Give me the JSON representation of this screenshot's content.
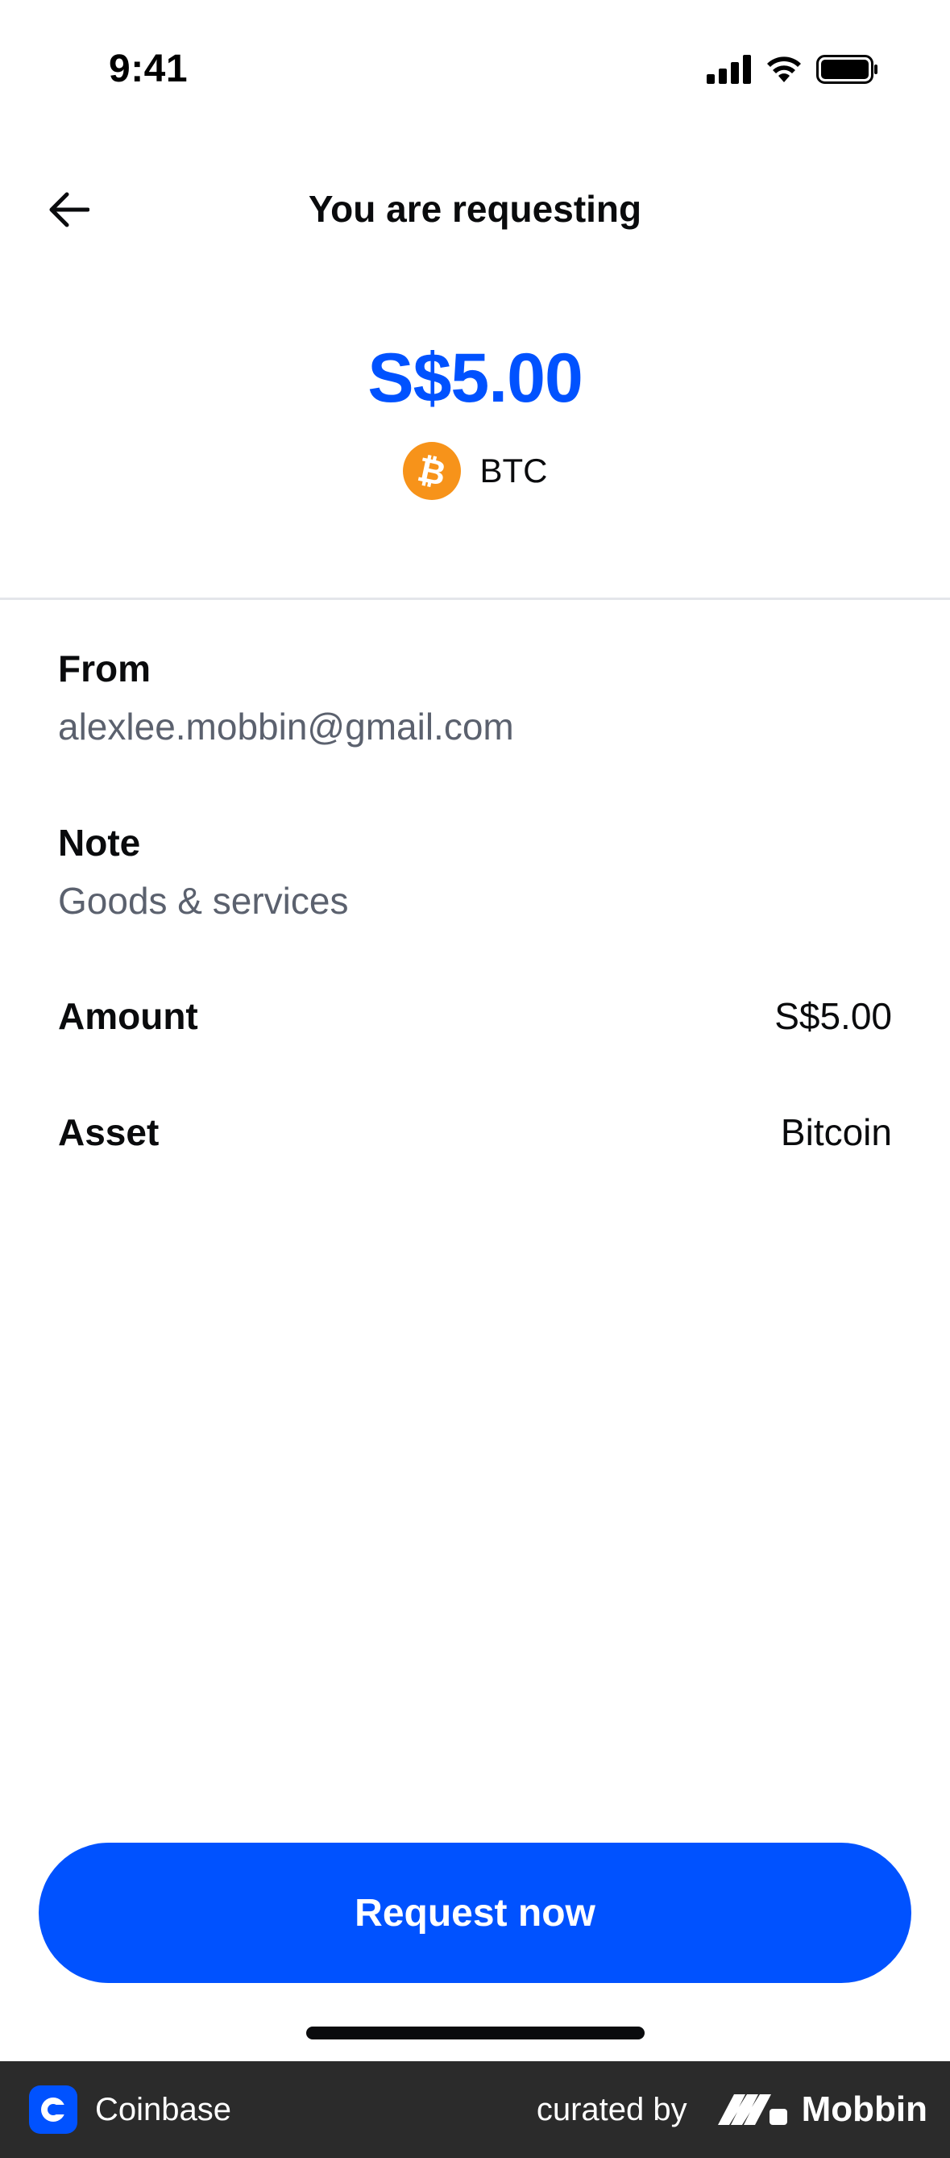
{
  "status_bar": {
    "time": "9:41"
  },
  "header": {
    "title": "You are requesting",
    "back_icon": "arrow-left-icon"
  },
  "amount": {
    "value": "S$5.00",
    "asset_code": "BTC",
    "asset_icon": "bitcoin-icon"
  },
  "details": {
    "from": {
      "label": "From",
      "value": "alexlee.mobbin@gmail.com"
    },
    "note": {
      "label": "Note",
      "value": "Goods & services"
    },
    "amount": {
      "label": "Amount",
      "value": "S$5.00"
    },
    "asset": {
      "label": "Asset",
      "value": "Bitcoin"
    }
  },
  "primary_action": {
    "label": "Request now"
  },
  "footer": {
    "app_name": "Coinbase",
    "curated_by": "curated by",
    "brand": "Mobbin"
  },
  "colors": {
    "accent": "#0052ff",
    "bitcoin": "#f7931a",
    "muted_text": "#5b616e",
    "footer_bg": "#2b2b2b"
  }
}
